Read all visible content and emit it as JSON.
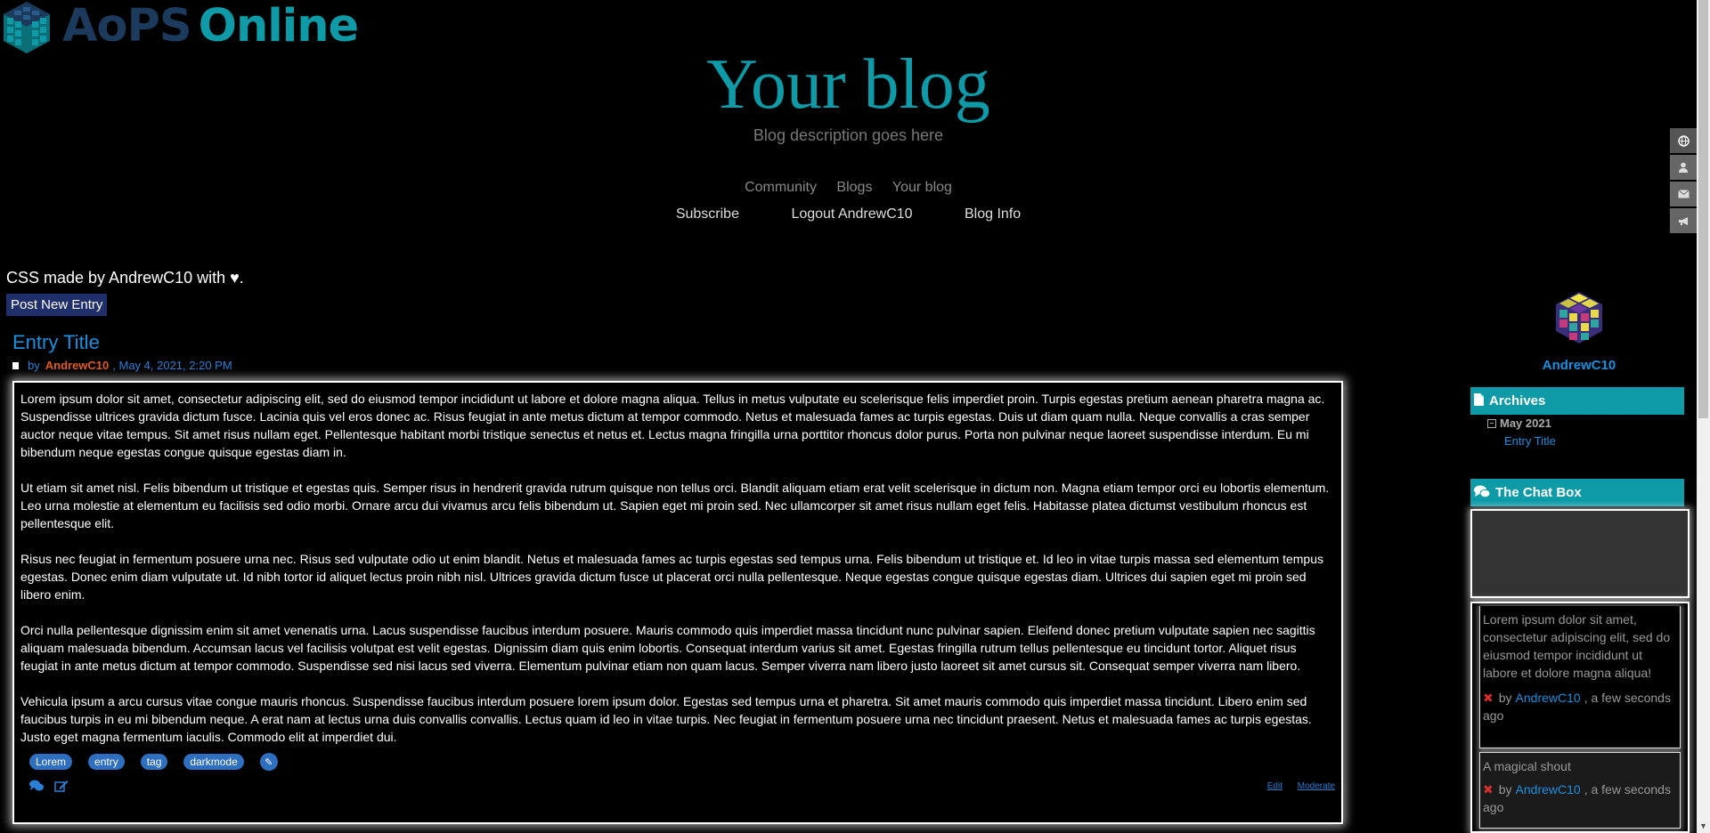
{
  "logo": {
    "text_aops": "AoPS",
    "text_online": "Online"
  },
  "header": {
    "title": "Your blog",
    "description": "Blog description goes here"
  },
  "nav": {
    "top": [
      "Community",
      "Blogs",
      "Your blog"
    ],
    "sub": [
      "Subscribe",
      "Logout AndrewC10",
      "Blog Info"
    ]
  },
  "side_icons": [
    "globe-icon",
    "user-icon",
    "envelope-icon",
    "bullhorn-icon"
  ],
  "credit": "CSS made by AndrewC10 with ♥.",
  "post_new_label": "Post New Entry",
  "entry": {
    "title": "Entry Title",
    "by": "by",
    "author": "AndrewC10",
    "date": ", May 4, 2021, 2:20 PM",
    "paragraphs": [
      "Lorem ipsum dolor sit amet, consectetur adipiscing elit, sed do eiusmod tempor incididunt ut labore et dolore magna aliqua. Tellus in metus vulputate eu scelerisque felis imperdiet proin. Turpis egestas pretium aenean pharetra magna ac. Suspendisse ultrices gravida dictum fusce. Lacinia quis vel eros donec ac. Risus feugiat in ante metus dictum at tempor commodo. Netus et malesuada fames ac turpis egestas. Duis ut diam quam nulla. Neque convallis a cras semper auctor neque vitae tempus. Sit amet risus nullam eget. Pellentesque habitant morbi tristique senectus et netus et. Lectus magna fringilla urna porttitor rhoncus dolor purus. Porta non pulvinar neque laoreet suspendisse interdum. Eu mi bibendum neque egestas congue quisque egestas diam in.",
      "Ut etiam sit amet nisl. Felis bibendum ut tristique et egestas quis. Semper risus in hendrerit gravida rutrum quisque non tellus orci. Blandit aliquam etiam erat velit scelerisque in dictum non. Magna etiam tempor orci eu lobortis elementum. Leo urna molestie at elementum eu facilisis sed odio morbi. Ornare arcu dui vivamus arcu felis bibendum ut. Sapien eget mi proin sed. Nec ullamcorper sit amet risus nullam eget felis. Habitasse platea dictumst vestibulum rhoncus est pellentesque elit.",
      "Risus nec feugiat in fermentum posuere urna nec. Risus sed vulputate odio ut enim blandit. Netus et malesuada fames ac turpis egestas sed tempus urna. Felis bibendum ut tristique et. Id leo in vitae turpis massa sed elementum tempus egestas. Donec enim diam vulputate ut. Id nibh tortor id aliquet lectus proin nibh nisl. Ultrices gravida dictum fusce ut placerat orci nulla pellentesque. Neque egestas congue quisque egestas diam. Ultrices dui sapien eget mi proin sed libero enim.",
      "Orci nulla pellentesque dignissim enim sit amet venenatis urna. Lacus suspendisse faucibus interdum posuere. Mauris commodo quis imperdiet massa tincidunt nunc pulvinar sapien. Eleifend donec pretium vulputate sapien nec sagittis aliquam malesuada bibendum. Accumsan lacus vel facilisis volutpat est velit egestas. Dignissim diam quis enim lobortis. Consequat interdum varius sit amet. Egestas fringilla rutrum tellus pellentesque eu tincidunt tortor. Aliquet risus feugiat in ante metus dictum at tempor commodo. Suspendisse sed nisi lacus sed viverra. Elementum pulvinar etiam non quam lacus. Semper viverra nam libero justo laoreet sit amet cursus sit. Consequat semper viverra nam libero.",
      "Vehicula ipsum a arcu cursus vitae congue mauris rhoncus. Suspendisse faucibus interdum posuere lorem ipsum dolor. Egestas sed tempus urna et pharetra. Sit amet mauris commodo quis imperdiet massa tincidunt. Libero enim sed faucibus turpis in eu mi bibendum neque. A erat nam at lectus urna duis convallis convallis. Lectus quam id leo in vitae turpis. Nec feugiat in fermentum posuere urna nec tincidunt praesent. Netus et malesuada fames ac turpis egestas. Justo eget magna fermentum iaculis. Commodo elit at imperdiet dui."
    ],
    "tags": [
      "Lorem",
      "entry",
      "tag",
      "darkmode"
    ],
    "links": {
      "edit": "Edit",
      "moderate": "Moderate"
    }
  },
  "sidebar": {
    "profile_name": "AndrewC10",
    "archives": {
      "title": "Archives",
      "month": "May 2021",
      "entries": [
        "Entry Title"
      ]
    },
    "chat": {
      "title": "The Chat Box",
      "shouts": [
        {
          "text": "Lorem ipsum dolor sit amet, consectetur adipiscing elit, sed do eiusmod tempor incididunt ut labore et dolore magna aliqua!",
          "by": "by",
          "author": "AndrewC10",
          "time": ", a few seconds ago"
        },
        {
          "text": "A magical shout",
          "by": "by",
          "author": "AndrewC10",
          "time": ", a few seconds ago"
        }
      ]
    }
  },
  "colors": {
    "accent": "#0e9aa7",
    "link": "#1a8fe0",
    "author": "#e05a1b",
    "button": "#1e2f6b"
  }
}
